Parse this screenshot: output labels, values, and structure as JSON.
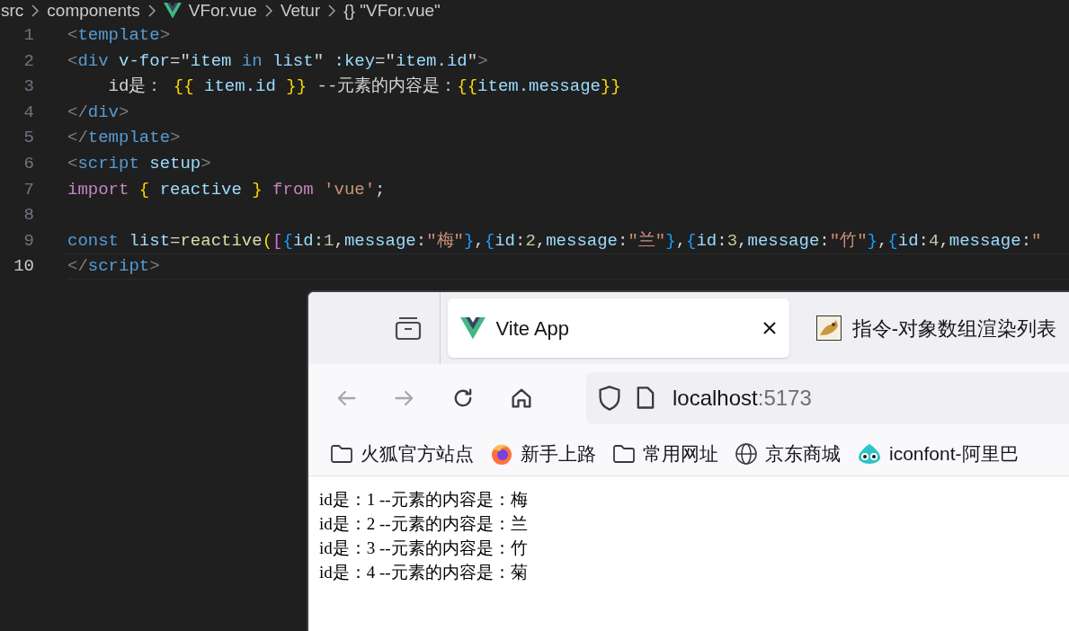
{
  "breadcrumb": [
    {
      "label": "src",
      "kind": "folder"
    },
    {
      "label": "components",
      "kind": "folder"
    },
    {
      "label": "VFor.vue",
      "kind": "vue"
    },
    {
      "label": "Vetur",
      "kind": "folder"
    },
    {
      "label": "{} \"VFor.vue\"",
      "kind": "symbol"
    }
  ],
  "editor": {
    "lines": [
      {
        "number": "1",
        "current": false,
        "tokens": [
          {
            "kind": "punct",
            "text": "<"
          },
          {
            "kind": "tag",
            "text": "template"
          },
          {
            "kind": "punct",
            "text": ">"
          }
        ]
      },
      {
        "number": "2",
        "current": false,
        "tokens": [
          {
            "kind": "punct",
            "text": "<"
          },
          {
            "kind": "tag",
            "text": "div "
          },
          {
            "kind": "attr",
            "text": "v-for"
          },
          {
            "kind": "text",
            "text": "=\""
          },
          {
            "kind": "ident",
            "text": "item"
          },
          {
            "kind": "tag",
            "text": " in "
          },
          {
            "kind": "ident",
            "text": "list"
          },
          {
            "kind": "text",
            "text": "\" "
          },
          {
            "kind": "attr",
            "text": ":key"
          },
          {
            "kind": "text",
            "text": "=\""
          },
          {
            "kind": "ident",
            "text": "item.id"
          },
          {
            "kind": "text",
            "text": "\""
          },
          {
            "kind": "punct",
            "text": ">"
          }
        ]
      },
      {
        "number": "3",
        "current": false,
        "tokens": [
          {
            "kind": "text",
            "text": "    id是： "
          },
          {
            "kind": "brace1",
            "text": "{{"
          },
          {
            "kind": "ident",
            "text": " item.id "
          },
          {
            "kind": "brace1",
            "text": "}}"
          },
          {
            "kind": "text",
            "text": " --元素的内容是："
          },
          {
            "kind": "brace1",
            "text": "{{"
          },
          {
            "kind": "ident",
            "text": "item.message"
          },
          {
            "kind": "brace1",
            "text": "}}"
          }
        ]
      },
      {
        "number": "4",
        "current": false,
        "tokens": [
          {
            "kind": "punct",
            "text": "</"
          },
          {
            "kind": "tag",
            "text": "div"
          },
          {
            "kind": "punct",
            "text": ">"
          }
        ]
      },
      {
        "number": "5",
        "current": false,
        "tokens": [
          {
            "kind": "punct",
            "text": "</"
          },
          {
            "kind": "tag",
            "text": "template"
          },
          {
            "kind": "punct",
            "text": ">"
          }
        ]
      },
      {
        "number": "6",
        "current": false,
        "tokens": [
          {
            "kind": "punct",
            "text": "<"
          },
          {
            "kind": "tag",
            "text": "script "
          },
          {
            "kind": "attr",
            "text": "setup"
          },
          {
            "kind": "punct",
            "text": ">"
          }
        ]
      },
      {
        "number": "7",
        "current": false,
        "tokens": [
          {
            "kind": "kw",
            "text": "import "
          },
          {
            "kind": "brace1",
            "text": "{"
          },
          {
            "kind": "ident",
            "text": " reactive "
          },
          {
            "kind": "brace1",
            "text": "}"
          },
          {
            "kind": "kw",
            "text": " from "
          },
          {
            "kind": "str",
            "text": "'vue'"
          },
          {
            "kind": "text",
            "text": ";"
          }
        ]
      },
      {
        "number": "8",
        "current": false
      },
      {
        "number": "9",
        "current": false,
        "tokens": [
          {
            "kind": "tag",
            "text": "const "
          },
          {
            "kind": "ident",
            "text": "list"
          },
          {
            "kind": "text",
            "text": "="
          },
          {
            "kind": "func",
            "text": "reactive"
          },
          {
            "kind": "brace1",
            "text": "("
          },
          {
            "kind": "brace2",
            "text": "["
          },
          {
            "kind": "brace3",
            "text": "{"
          },
          {
            "kind": "ident",
            "text": "id"
          },
          {
            "kind": "text",
            "text": ":"
          },
          {
            "kind": "num",
            "text": "1"
          },
          {
            "kind": "text",
            "text": ","
          },
          {
            "kind": "ident",
            "text": "message"
          },
          {
            "kind": "text",
            "text": ":"
          },
          {
            "kind": "str",
            "text": "\"梅\""
          },
          {
            "kind": "brace3",
            "text": "}"
          },
          {
            "kind": "text",
            "text": ","
          },
          {
            "kind": "brace3",
            "text": "{"
          },
          {
            "kind": "ident",
            "text": "id"
          },
          {
            "kind": "text",
            "text": ":"
          },
          {
            "kind": "num",
            "text": "2"
          },
          {
            "kind": "text",
            "text": ","
          },
          {
            "kind": "ident",
            "text": "message"
          },
          {
            "kind": "text",
            "text": ":"
          },
          {
            "kind": "str",
            "text": "\"兰\""
          },
          {
            "kind": "brace3",
            "text": "}"
          },
          {
            "kind": "text",
            "text": ","
          },
          {
            "kind": "brace3",
            "text": "{"
          },
          {
            "kind": "ident",
            "text": "id"
          },
          {
            "kind": "text",
            "text": ":"
          },
          {
            "kind": "num",
            "text": "3"
          },
          {
            "kind": "text",
            "text": ","
          },
          {
            "kind": "ident",
            "text": "message"
          },
          {
            "kind": "text",
            "text": ":"
          },
          {
            "kind": "str",
            "text": "\"竹\""
          },
          {
            "kind": "brace3",
            "text": "}"
          },
          {
            "kind": "text",
            "text": ","
          },
          {
            "kind": "brace3",
            "text": "{"
          },
          {
            "kind": "ident",
            "text": "id"
          },
          {
            "kind": "text",
            "text": ":"
          },
          {
            "kind": "num",
            "text": "4"
          },
          {
            "kind": "text",
            "text": ","
          },
          {
            "kind": "ident",
            "text": "message"
          },
          {
            "kind": "text",
            "text": ":"
          },
          {
            "kind": "str",
            "text": "\""
          }
        ]
      },
      {
        "number": "10",
        "current": true,
        "tokens": [
          {
            "kind": "punct",
            "text": "</"
          },
          {
            "kind": "tag",
            "text": "script"
          },
          {
            "kind": "punct",
            "text": ">"
          }
        ]
      }
    ]
  },
  "browser": {
    "tabs": [
      {
        "title": "Vite App",
        "selected": true,
        "kind": "vue"
      },
      {
        "title": "指令-对象数组渲染列表",
        "selected": false,
        "kind": "image"
      }
    ],
    "nav": [
      {
        "kind": "back",
        "disabled": true
      },
      {
        "kind": "forward",
        "disabled": true
      },
      {
        "kind": "reload",
        "disabled": false
      },
      {
        "kind": "home",
        "disabled": false
      }
    ],
    "url": {
      "host": "localhost",
      "port": ":5173"
    },
    "bookmarks": [
      {
        "label": "火狐官方站点",
        "kind": "folder"
      },
      {
        "label": "新手上路",
        "kind": "firefox"
      },
      {
        "label": "常用网址",
        "kind": "folder"
      },
      {
        "label": "京东商城",
        "kind": "globe"
      },
      {
        "label": "iconfont-阿里巴",
        "kind": "app"
      }
    ],
    "content": [
      "id是：1 --元素的内容是：梅",
      "id是：2 --元素的内容是：兰",
      "id是：3 --元素的内容是：竹",
      "id是：4 --元素的内容是：菊"
    ]
  }
}
